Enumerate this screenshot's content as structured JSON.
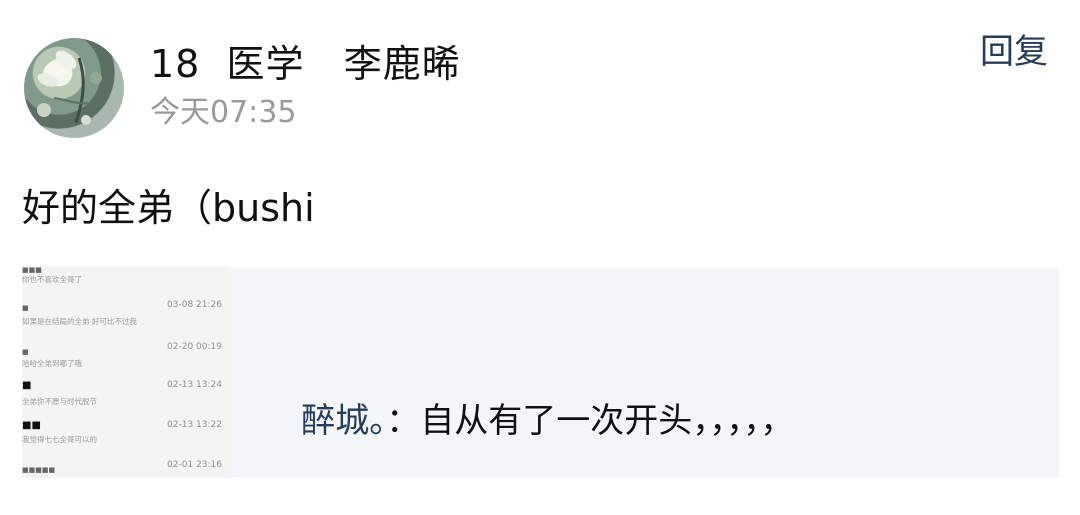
{
  "post": {
    "username": "18  医学   李鹿晞",
    "time": "今天07:35",
    "reply_label": "回复",
    "content": "好的全弟（bushi"
  },
  "attachment": {
    "rows": [
      {
        "time": "",
        "text": "你也不喜欢全哥了"
      },
      {
        "time": "03-08 21:26",
        "text": "如果是在结局的全弟 好可比不过我"
      },
      {
        "time": "02-20 00:19",
        "text": "哈哈全弟到哪了哦"
      },
      {
        "time": "02-13 13:24",
        "text": "全弟你不愿与时代脱节"
      },
      {
        "time": "02-13 13:22",
        "text": "我觉得七七全哥可以的"
      },
      {
        "time": "02-01 23:16",
        "text": ""
      }
    ]
  },
  "quote": {
    "name": "醉城。",
    "separator": "：",
    "text": "自从有了一次开头，，，，，"
  },
  "colors": {
    "accent": "#253d5b",
    "timestamp": "#9a9a9a",
    "quote_bg": "#f3f5f8"
  }
}
